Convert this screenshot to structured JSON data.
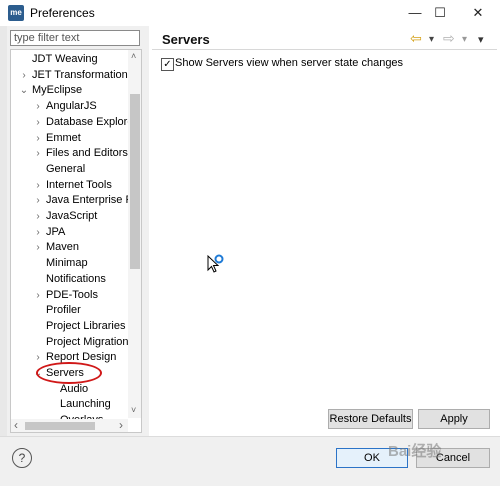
{
  "window": {
    "icon_text": "me",
    "title": "Preferences",
    "controls": {
      "minimize": "—",
      "maximize": "☐",
      "close": "✕"
    }
  },
  "filter": {
    "placeholder": "type filter text"
  },
  "tree": {
    "rows": [
      {
        "label": "JDT Weaving",
        "expander": ""
      },
      {
        "label": "JET Transformations",
        "expander": "›"
      },
      {
        "label": "MyEclipse",
        "expander": "⌄"
      },
      {
        "label": "AngularJS",
        "expander": "›"
      },
      {
        "label": "Database Explorer",
        "expander": "›"
      },
      {
        "label": "Emmet",
        "expander": "›"
      },
      {
        "label": "Files and Editors",
        "expander": "›"
      },
      {
        "label": "General",
        "expander": ""
      },
      {
        "label": "Internet Tools",
        "expander": "›"
      },
      {
        "label": "Java Enterprise Pro",
        "expander": "›"
      },
      {
        "label": "JavaScript",
        "expander": "›"
      },
      {
        "label": "JPA",
        "expander": "›"
      },
      {
        "label": "Maven",
        "expander": "›"
      },
      {
        "label": "Minimap",
        "expander": ""
      },
      {
        "label": "Notifications",
        "expander": ""
      },
      {
        "label": "PDE-Tools",
        "expander": "›"
      },
      {
        "label": "Profiler",
        "expander": ""
      },
      {
        "label": "Project Libraries",
        "expander": ""
      },
      {
        "label": "Project Migration",
        "expander": ""
      },
      {
        "label": "Report Design",
        "expander": "›"
      },
      {
        "label": "Servers",
        "expander": "⌄"
      },
      {
        "label": "Audio",
        "expander": ""
      },
      {
        "label": "Launching",
        "expander": ""
      },
      {
        "label": "Overlays",
        "expander": ""
      }
    ],
    "scroll_arrows": {
      "up": "˄",
      "down": "˅",
      "left": "‹",
      "right": "›"
    }
  },
  "page": {
    "title": "Servers",
    "nav": {
      "back": "⇦",
      "back_menu": "▾",
      "forward": "⇨",
      "forward_menu": "▾",
      "view_menu": "▾"
    },
    "checkbox": {
      "checked": true,
      "mark": "✓",
      "label": "Show Servers view when server state changes"
    },
    "restore_defaults": "Restore Defaults",
    "apply": "Apply"
  },
  "footer": {
    "help_icon": "?",
    "ok": "OK",
    "cancel": "Cancel"
  },
  "watermark": "Bai经验",
  "colors": {
    "accent": "#2b73c7",
    "highlight_circle": "#d01818",
    "nav_arrow": "#d4a017"
  }
}
